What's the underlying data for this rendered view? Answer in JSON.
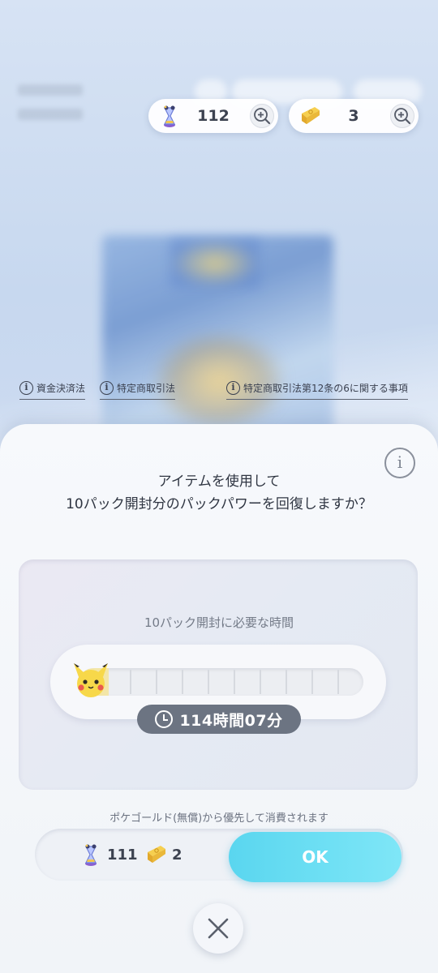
{
  "currency": {
    "hourglass_count": "112",
    "gold_count": "3"
  },
  "legal_links": [
    {
      "label": "資金決済法"
    },
    {
      "label": "特定商取引法"
    },
    {
      "label": "特定商取引法第12条の6に関する事項"
    }
  ],
  "dialog": {
    "question_line1": "アイテムを使用して",
    "question_line2": "10パック開封分のパックパワーを回復しますか？",
    "needed_time_label": "10パック開封に必要な時間",
    "time_remaining": "114時間07分",
    "gauge_segments": 10,
    "gauge_filled_fraction": 0.1,
    "priority_note": "ポケゴールド(無償)から優先して消費されます",
    "after_hourglass": "111",
    "after_gold": "2",
    "ok_label": "OK"
  },
  "colors": {
    "accent_ok": "#5ad6ef",
    "badge_bg": "#6c7482"
  },
  "icons": [
    "hourglass-icon",
    "gold-bar-icon",
    "zoom-plus-icon",
    "info-icon",
    "pikachu-icon",
    "clock-icon",
    "close-icon"
  ]
}
